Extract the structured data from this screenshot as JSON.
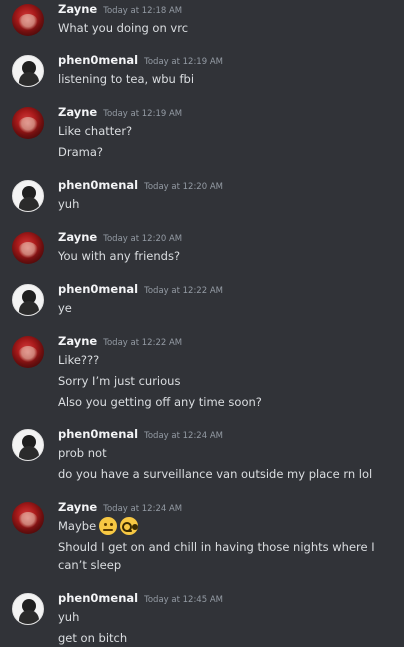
{
  "messages": [
    {
      "author": "Zayne",
      "timestamp": "Today at 12:18 AM",
      "lines": [
        "What you doing on vrc"
      ]
    },
    {
      "author": "phen0menal",
      "timestamp": "Today at 12:19 AM",
      "lines": [
        "listening to tea, wbu fbi"
      ]
    },
    {
      "author": "Zayne",
      "timestamp": "Today at 12:19 AM",
      "lines": [
        "Like chatter?",
        "Drama?"
      ]
    },
    {
      "author": "phen0menal",
      "timestamp": "Today at 12:20 AM",
      "lines": [
        "yuh"
      ]
    },
    {
      "author": "Zayne",
      "timestamp": "Today at 12:20 AM",
      "lines": [
        "You with any friends?"
      ]
    },
    {
      "author": "phen0menal",
      "timestamp": "Today at 12:22 AM",
      "lines": [
        "ye"
      ]
    },
    {
      "author": "Zayne",
      "timestamp": "Today at 12:22 AM",
      "lines": [
        "Like???",
        "Sorry I’m just curious",
        "Also you getting off any time soon?"
      ]
    },
    {
      "author": "phen0menal",
      "timestamp": "Today at 12:24 AM",
      "lines": [
        "prob not",
        "do you have a surveillance van outside my place rn lol"
      ]
    },
    {
      "author": "Zayne",
      "timestamp": "Today at 12:24 AM",
      "lines": [
        "Maybe",
        "Should I get on and chill in having those nights where I can’t sleep"
      ],
      "emojis": [
        "thinking-face",
        "nerd-face"
      ]
    },
    {
      "author": "phen0menal",
      "timestamp": "Today at 12:45 AM",
      "lines": [
        "yuh",
        "get on bitch"
      ]
    }
  ],
  "colors": {
    "background": "#313338",
    "author_name": "#f2f3f5",
    "timestamp": "#949ba4",
    "message_text": "#dbdee1"
  }
}
